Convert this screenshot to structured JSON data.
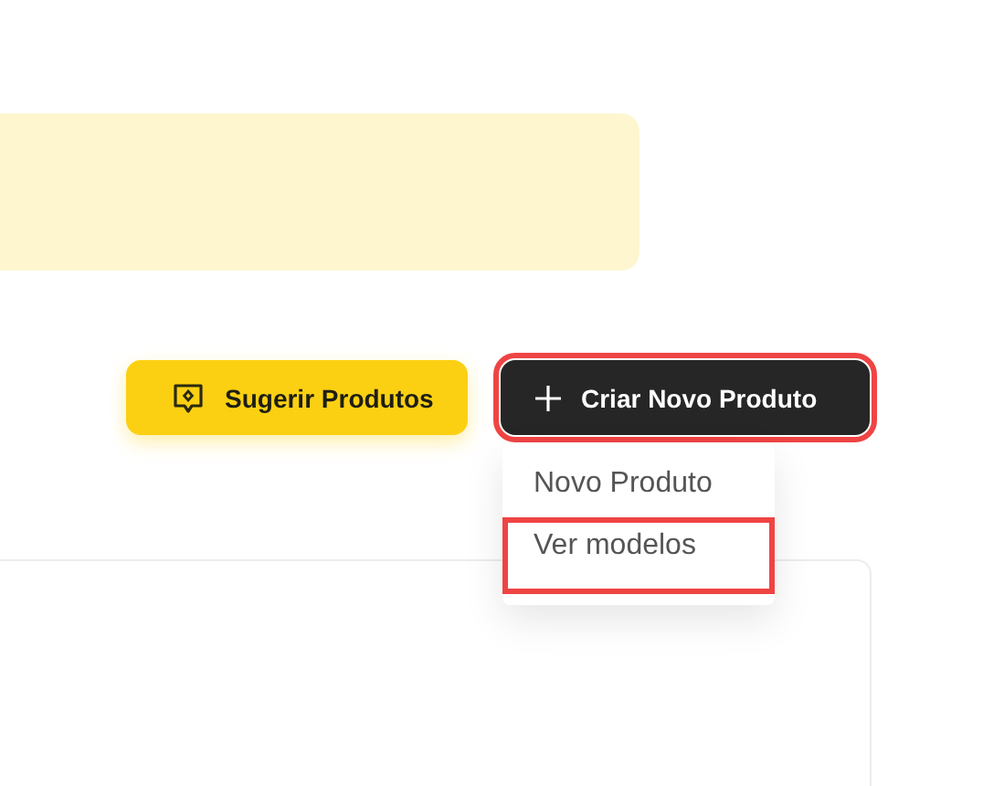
{
  "banner": {
    "kind": "notice"
  },
  "buttons": [
    {
      "label": "Sugerir Produtos",
      "kind": "suggest",
      "highlighted": false
    },
    {
      "label": "Criar Novo Produto",
      "kind": "create",
      "highlighted": true
    }
  ],
  "menu": {
    "items": [
      {
        "label": "Novo Produto",
        "highlighted": false
      },
      {
        "label": "Ver modelos",
        "highlighted": true
      }
    ]
  }
}
